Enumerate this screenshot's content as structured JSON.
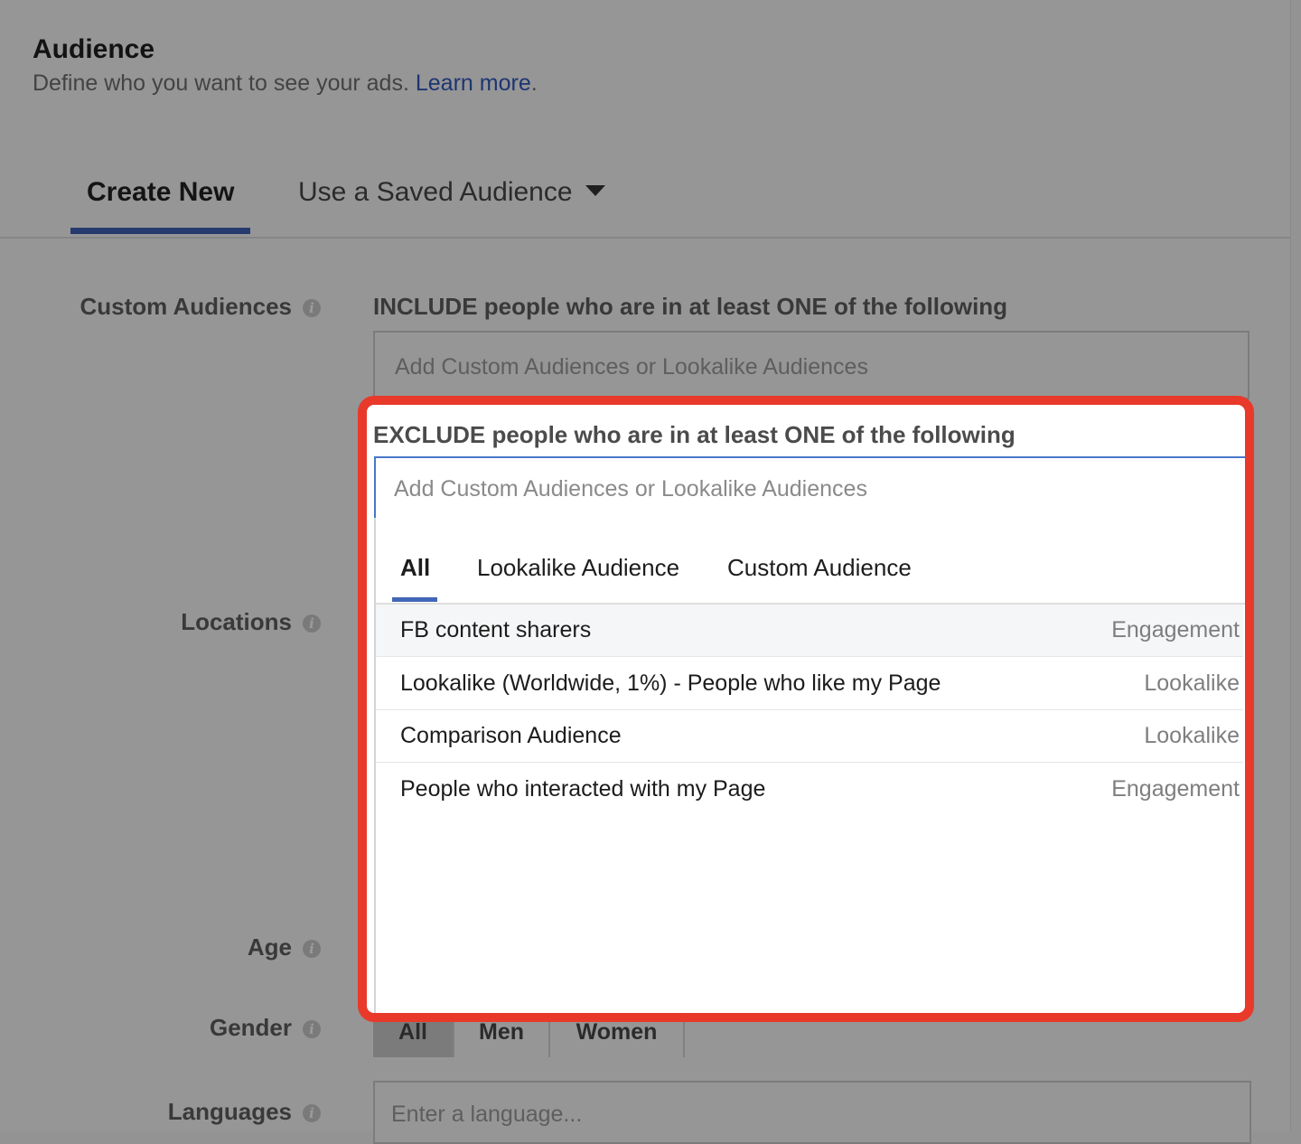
{
  "header": {
    "title": "Audience",
    "subtitle": "Define who you want to see your ads.",
    "learn_more": "Learn more",
    "period": "."
  },
  "tabs": {
    "create_new": "Create New",
    "saved": "Use a Saved Audience"
  },
  "labels": {
    "custom_audiences": "Custom Audiences",
    "locations": "Locations",
    "age": "Age",
    "gender": "Gender",
    "languages": "Languages"
  },
  "include": {
    "heading": "INCLUDE people who are in at least ONE of the following",
    "placeholder": "Add Custom Audiences or Lookalike Audiences"
  },
  "exclude": {
    "heading": "EXCLUDE people who are in at least ONE of the following",
    "placeholder": "Add Custom Audiences or Lookalike Audiences"
  },
  "dropdown": {
    "tabs": [
      "All",
      "Lookalike Audience",
      "Custom Audience"
    ],
    "active_tab": "All",
    "rows": [
      {
        "name": "FB content sharers",
        "type": "Engagement"
      },
      {
        "name": "Lookalike (Worldwide, 1%) - People who like my Page",
        "type": "Lookalike"
      },
      {
        "name": "Comparison Audience",
        "type": "Lookalike"
      },
      {
        "name": "People who interacted with my Page",
        "type": "Engagement"
      }
    ]
  },
  "gender": {
    "options": [
      "All",
      "Men",
      "Women"
    ],
    "selected": "All"
  },
  "languages": {
    "placeholder": "Enter a language..."
  },
  "colors": {
    "highlight_border": "#e8392a",
    "accent": "#4266b7",
    "tab_underline": "#263a6f"
  }
}
